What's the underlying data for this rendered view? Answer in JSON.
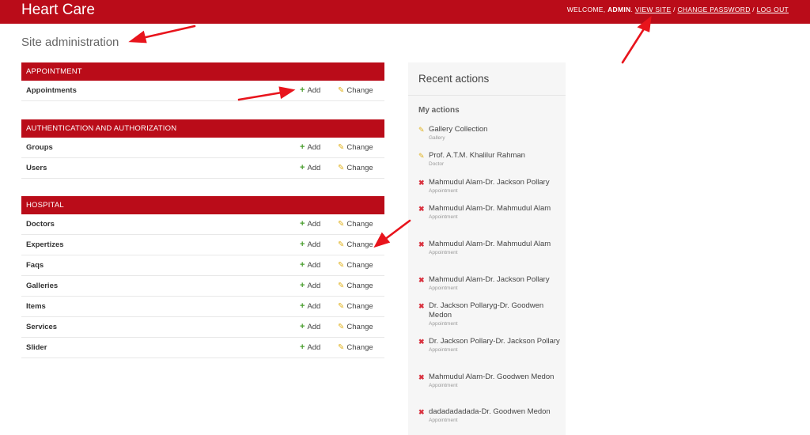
{
  "header": {
    "brand": "Heart Care",
    "welcome_prefix": "WELCOME, ",
    "username": "ADMIN",
    "welcome_suffix": ". ",
    "view_site": "VIEW SITE",
    "sep1": " / ",
    "change_password": "CHANGE PASSWORD",
    "sep2": " / ",
    "log_out": "LOG OUT"
  },
  "page_title": "Site administration",
  "link_labels": {
    "add": "Add",
    "change": "Change"
  },
  "modules": [
    {
      "title": "APPOINTMENT",
      "models": [
        "Appointments"
      ]
    },
    {
      "title": "AUTHENTICATION AND AUTHORIZATION",
      "models": [
        "Groups",
        "Users"
      ]
    },
    {
      "title": "HOSPITAL",
      "models": [
        "Doctors",
        "Expertizes",
        "Faqs",
        "Galleries",
        "Items",
        "Services",
        "Slider"
      ]
    }
  ],
  "recent_actions": {
    "title": "Recent actions",
    "subtitle": "My actions",
    "items": [
      {
        "kind": "changed",
        "text": "Gallery Collection",
        "type": "Gallery"
      },
      {
        "kind": "changed",
        "text": "Prof. A.T.M. Khalilur Rahman",
        "type": "Doctor"
      },
      {
        "kind": "deleted",
        "text": "Mahmudul Alam-Dr. Jackson Pollary",
        "type": "Appointment"
      },
      {
        "kind": "deleted",
        "text": "Mahmudul Alam-Dr. Mahmudul Alam",
        "type": "Appointment"
      },
      {
        "kind": "deleted",
        "text": "Mahmudul Alam-Dr. Mahmudul Alam",
        "type": "Appointment"
      },
      {
        "kind": "deleted",
        "text": "Mahmudul Alam-Dr. Jackson Pollary",
        "type": "Appointment"
      },
      {
        "kind": "deleted",
        "text": "Dr. Jackson Pollaryg-Dr. Goodwen Medon",
        "type": "Appointment"
      },
      {
        "kind": "deleted",
        "text": "Dr. Jackson Pollary-Dr. Jackson Pollary",
        "type": "Appointment"
      },
      {
        "kind": "deleted",
        "text": "Mahmudul Alam-Dr. Goodwen Medon",
        "type": "Appointment"
      },
      {
        "kind": "deleted",
        "text": "dadadadadada-Dr. Goodwen Medon",
        "type": "Appointment"
      }
    ]
  },
  "colors": {
    "brand": "#ba0c19",
    "add_icon": "#4a9e2f",
    "change_icon": "#e0b21f",
    "delete_icon": "#d9323f"
  },
  "icons": {
    "add": "plus-icon",
    "change": "pencil-icon",
    "delete": "x-icon"
  }
}
